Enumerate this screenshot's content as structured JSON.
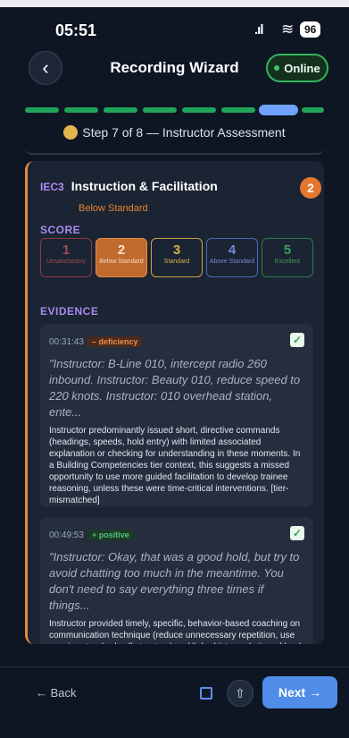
{
  "status_bar": {
    "time": "05:51",
    "battery": "96"
  },
  "header": {
    "title": "Recording Wizard",
    "online_label": "Online"
  },
  "step": {
    "text": "Step 7 of 8 — Instructor Assessment"
  },
  "competency": {
    "code": "IEC3",
    "title": "Instruction & Facilitation",
    "level": "Below Standard",
    "score_badge": "2"
  },
  "score_section": {
    "label": "SCORE",
    "options": [
      {
        "num": "1",
        "label": "Unsatisfactory"
      },
      {
        "num": "2",
        "label": "Below Standard"
      },
      {
        "num": "3",
        "label": "Standard"
      },
      {
        "num": "4",
        "label": "Above Standard"
      },
      {
        "num": "5",
        "label": "Excellent"
      }
    ]
  },
  "evidence_section": {
    "label": "EVIDENCE",
    "items": [
      {
        "time": "00:31:43",
        "tag": "– deficiency",
        "quote": "\"Instructor: B-Line 010, intercept radio 260 inbound. Instructor: Beauty 010, reduce speed to 220 knots. Instructor: 010 overhead station, ente...",
        "body": "Instructor predominantly issued short, directive commands (headings, speeds, hold entry) with limited associated explanation or checking for understanding in these moments. In a Building Competencies tier context, this suggests a missed opportunity to use more guided facilitation to develop trainee reasoning, unless these were time-critical interventions. [tier-mismatched]"
      },
      {
        "time": "00:49:53",
        "tag": "+ positive",
        "quote": "\"Instructor: Okay, that was a good hold, but try to avoid chatting too much in the meantime. You don't need to say everything three times if things...",
        "body": "Instructor provided timely, specific, behavior-based coaching on communication technique (reduce unnecessary repetition, use concise standard call structure) and linked it to cockpit workload management."
      }
    ]
  },
  "footer": {
    "back_label": "← Back",
    "next_label": "Next →"
  }
}
